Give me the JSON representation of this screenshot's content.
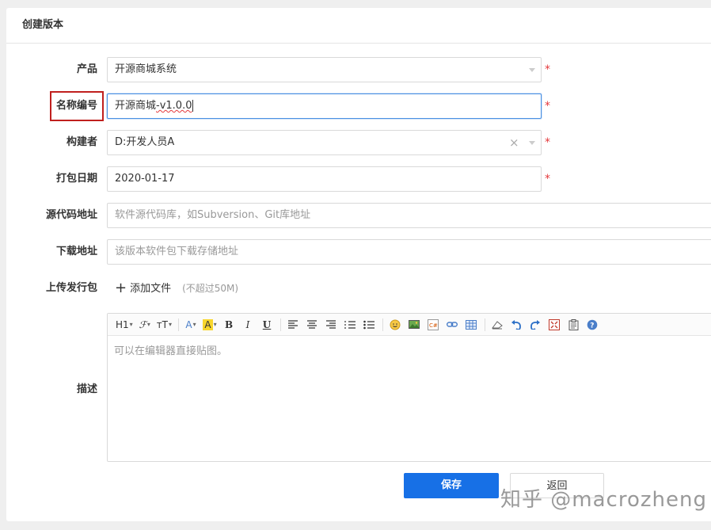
{
  "panel": {
    "title": "创建版本"
  },
  "form": {
    "product": {
      "label": "产品",
      "value": "开源商城系统",
      "required": "*"
    },
    "name": {
      "label": "名称编号",
      "value_prefix": "开源商城",
      "value_suffix": "-v1.0.0",
      "required": "*"
    },
    "builder": {
      "label": "构建者",
      "value": "D:开发人员A",
      "clear": "×",
      "required": "*"
    },
    "date": {
      "label": "打包日期",
      "value": "2020-01-17",
      "required": "*"
    },
    "source": {
      "label": "源代码地址",
      "placeholder": "软件源代码库，如Subversion、Git库地址"
    },
    "download": {
      "label": "下载地址",
      "placeholder": "该版本软件包下载存储地址"
    },
    "upload": {
      "label": "上传发行包",
      "plus": "+",
      "button": "添加文件",
      "hint": "(不超过50M)"
    },
    "description": {
      "label": "描述",
      "placeholder": "可以在编辑器直接贴图。"
    }
  },
  "toolbar": {
    "heading": "H1",
    "font": "ℱ",
    "size": "тT",
    "font_color": "A",
    "bg_color": "A",
    "bold": "B",
    "italic": "I",
    "underline": "U",
    "dropdown": "▾"
  },
  "buttons": {
    "save": "保存",
    "back": "返回"
  },
  "watermark": "知乎 @macrozheng",
  "colors": {
    "primary": "#1770e6",
    "required": "#e4393c",
    "highlight_box": "#c0201e",
    "focus_border": "#4a90e2"
  }
}
